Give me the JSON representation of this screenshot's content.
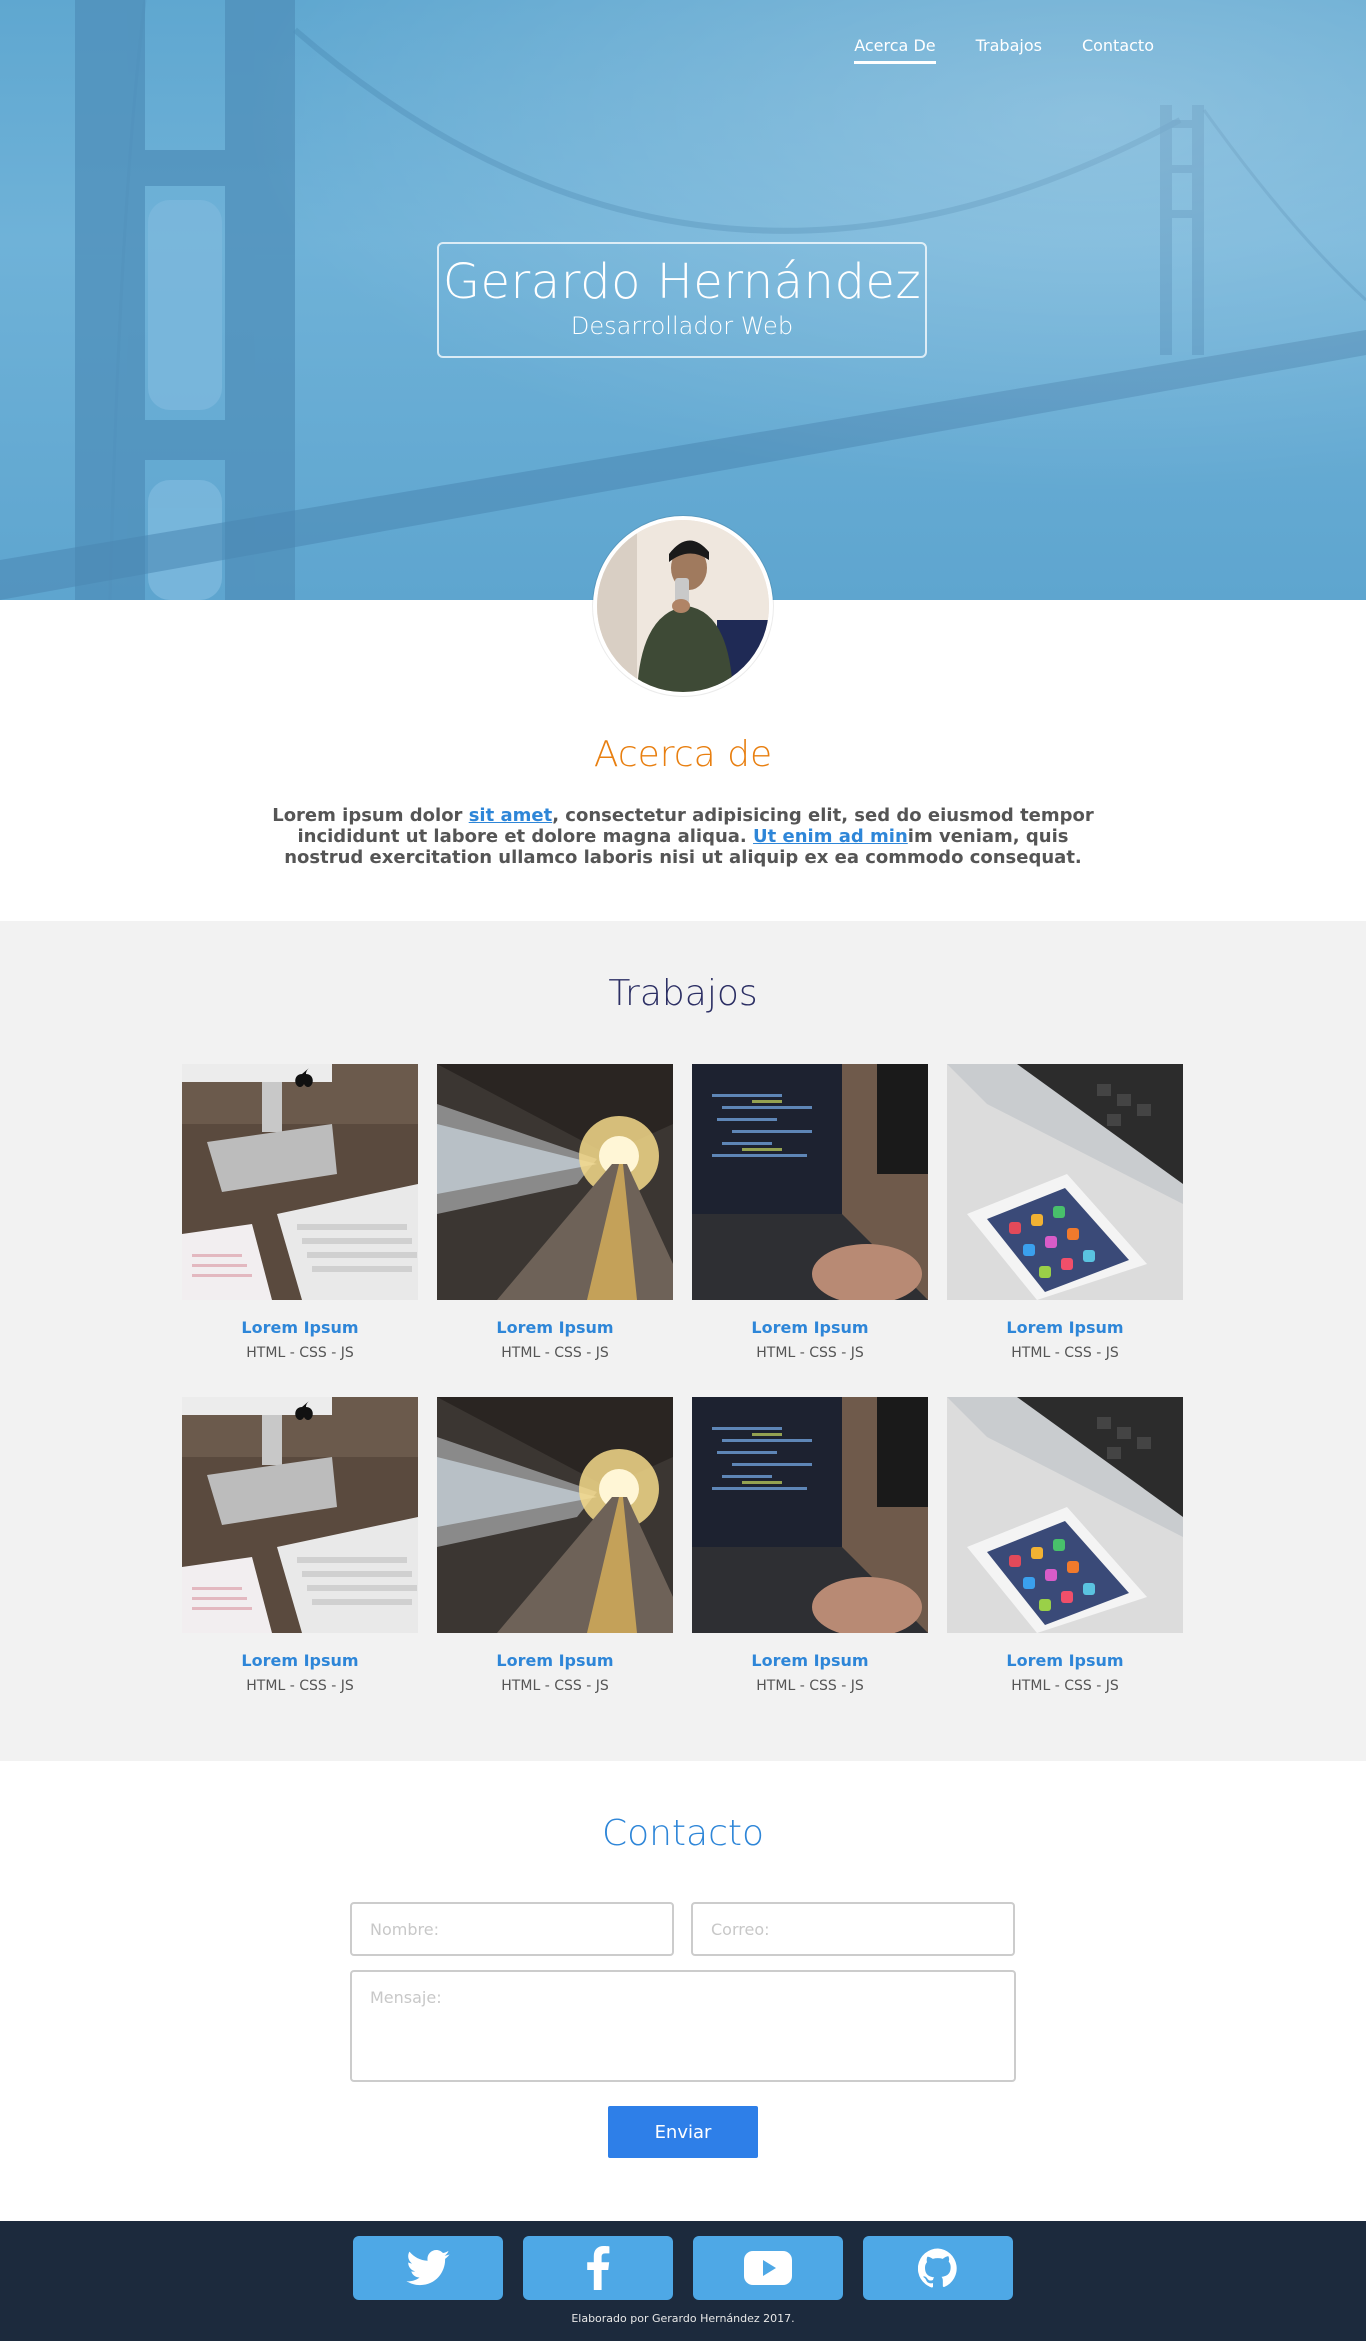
{
  "nav": {
    "items": [
      {
        "label": "Acerca De",
        "active": true
      },
      {
        "label": "Trabajos",
        "active": false
      },
      {
        "label": "Contacto",
        "active": false
      }
    ]
  },
  "hero": {
    "name": "Gerardo Hernández",
    "role": "Desarrollador Web"
  },
  "about": {
    "title": "Acerca de",
    "text_1": "Lorem ipsum dolor ",
    "link_1": "sit amet",
    "text_2": ", consectetur adipisicing elit, sed do eiusmod tempor incididunt ut labore et dolore magna aliqua. ",
    "link_2": "Ut enim ad min",
    "text_3": "im veniam, quis nostrud exercitation ullamco laboris nisi ut aliquip ex ea commodo consequat."
  },
  "works": {
    "title": "Trabajos",
    "items": [
      {
        "title": "Lorem Ipsum",
        "tags": "HTML - CSS - JS",
        "image": "desk-keyboard"
      },
      {
        "title": "Lorem Ipsum",
        "tags": "HTML - CSS - JS",
        "image": "train-platform"
      },
      {
        "title": "Lorem Ipsum",
        "tags": "HTML - CSS - JS",
        "image": "laptop-code"
      },
      {
        "title": "Lorem Ipsum",
        "tags": "HTML - CSS - JS",
        "image": "macbook-phone"
      },
      {
        "title": "Lorem Ipsum",
        "tags": "HTML - CSS - JS",
        "image": "desk-keyboard"
      },
      {
        "title": "Lorem Ipsum",
        "tags": "HTML - CSS - JS",
        "image": "train-platform"
      },
      {
        "title": "Lorem Ipsum",
        "tags": "HTML - CSS - JS",
        "image": "laptop-code"
      },
      {
        "title": "Lorem Ipsum",
        "tags": "HTML - CSS - JS",
        "image": "macbook-phone"
      }
    ]
  },
  "contact": {
    "title": "Contacto",
    "name_placeholder": "Nombre:",
    "email_placeholder": "Correo:",
    "message_placeholder": "Mensaje:",
    "send_label": "Enviar"
  },
  "footer": {
    "socials": [
      "twitter-icon",
      "facebook-icon",
      "youtube-icon",
      "github-icon"
    ],
    "credit": "Elaborado por Gerardo Hernández 2017."
  },
  "colors": {
    "hero_blue": "#6fb2d8",
    "about_title": "#e87f10",
    "works_title": "#2c2f64",
    "link_blue": "#2e86d8",
    "button_blue": "#2e7fe8",
    "social_blue": "#4ea8e6",
    "footer_bg": "#1c2a3d"
  }
}
